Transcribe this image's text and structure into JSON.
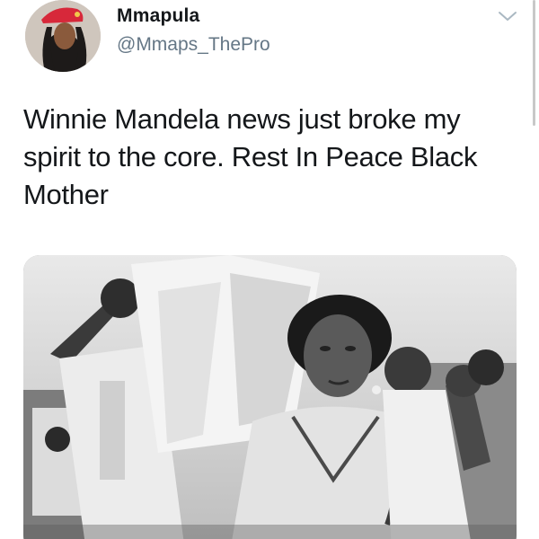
{
  "tweet": {
    "author": {
      "display_name": "Mmapula",
      "handle": "@Mmaps_ThePro",
      "avatar_icon": "profile-avatar"
    },
    "menu_icon": "chevron-down-icon",
    "text": "Winnie Mandela news just broke my spirit to the core. Rest In Peace Black Mother",
    "media": {
      "kind": "black-and-white photograph",
      "icon": "photo"
    }
  },
  "colors": {
    "name": "#14171a",
    "handle": "#657786",
    "text": "#14171a",
    "beret": "#d7283a",
    "caret": "#aab8c2"
  }
}
